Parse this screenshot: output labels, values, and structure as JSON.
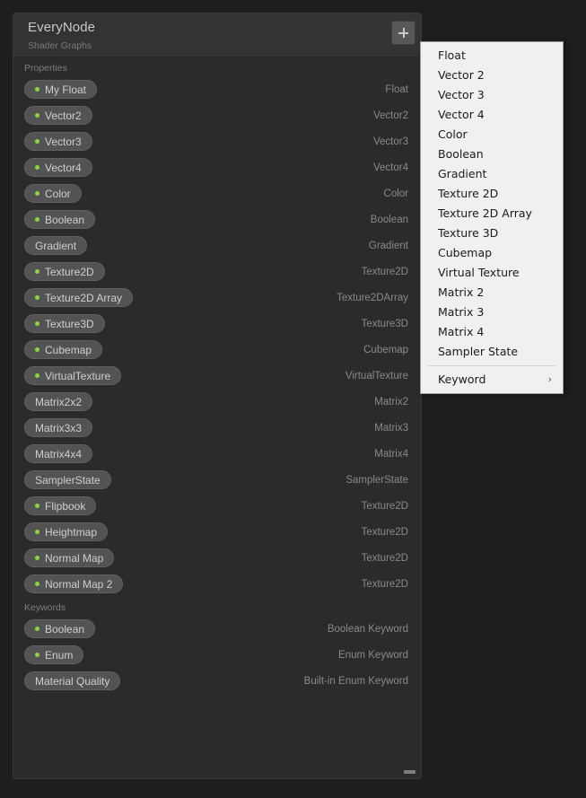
{
  "blackboard": {
    "title": "EveryNode",
    "subtitle": "Shader Graphs",
    "add_button_label": "+",
    "sections": [
      {
        "header": "Properties",
        "rows": [
          {
            "label": "My Float",
            "type": "Float",
            "has_dot": true
          },
          {
            "label": "Vector2",
            "type": "Vector2",
            "has_dot": true
          },
          {
            "label": "Vector3",
            "type": "Vector3",
            "has_dot": true
          },
          {
            "label": "Vector4",
            "type": "Vector4",
            "has_dot": true
          },
          {
            "label": "Color",
            "type": "Color",
            "has_dot": true
          },
          {
            "label": "Boolean",
            "type": "Boolean",
            "has_dot": true
          },
          {
            "label": "Gradient",
            "type": "Gradient",
            "has_dot": false
          },
          {
            "label": "Texture2D",
            "type": "Texture2D",
            "has_dot": true
          },
          {
            "label": "Texture2D Array",
            "type": "Texture2DArray",
            "has_dot": true
          },
          {
            "label": "Texture3D",
            "type": "Texture3D",
            "has_dot": true
          },
          {
            "label": "Cubemap",
            "type": "Cubemap",
            "has_dot": true
          },
          {
            "label": "VirtualTexture",
            "type": "VirtualTexture",
            "has_dot": true
          },
          {
            "label": "Matrix2x2",
            "type": "Matrix2",
            "has_dot": false
          },
          {
            "label": "Matrix3x3",
            "type": "Matrix3",
            "has_dot": false
          },
          {
            "label": "Matrix4x4",
            "type": "Matrix4",
            "has_dot": false
          },
          {
            "label": "SamplerState",
            "type": "SamplerState",
            "has_dot": false
          },
          {
            "label": "Flipbook",
            "type": "Texture2D",
            "has_dot": true
          },
          {
            "label": "Heightmap",
            "type": "Texture2D",
            "has_dot": true
          },
          {
            "label": "Normal Map",
            "type": "Texture2D",
            "has_dot": true
          },
          {
            "label": "Normal Map 2",
            "type": "Texture2D",
            "has_dot": true
          }
        ]
      },
      {
        "header": "Keywords",
        "rows": [
          {
            "label": "Boolean",
            "type": "Boolean Keyword",
            "has_dot": true
          },
          {
            "label": "Enum",
            "type": "Enum Keyword",
            "has_dot": true
          },
          {
            "label": "Material Quality",
            "type": "Built-in Enum Keyword",
            "has_dot": false
          }
        ]
      }
    ]
  },
  "dropdown": {
    "items": [
      {
        "label": "Float",
        "separator_before": false,
        "submenu": false
      },
      {
        "label": "Vector 2",
        "separator_before": false,
        "submenu": false
      },
      {
        "label": "Vector 3",
        "separator_before": false,
        "submenu": false
      },
      {
        "label": "Vector 4",
        "separator_before": false,
        "submenu": false
      },
      {
        "label": "Color",
        "separator_before": false,
        "submenu": false
      },
      {
        "label": "Boolean",
        "separator_before": false,
        "submenu": false
      },
      {
        "label": "Gradient",
        "separator_before": false,
        "submenu": false
      },
      {
        "label": "Texture 2D",
        "separator_before": false,
        "submenu": false
      },
      {
        "label": "Texture 2D Array",
        "separator_before": false,
        "submenu": false
      },
      {
        "label": "Texture 3D",
        "separator_before": false,
        "submenu": false
      },
      {
        "label": "Cubemap",
        "separator_before": false,
        "submenu": false
      },
      {
        "label": "Virtual Texture",
        "separator_before": false,
        "submenu": false
      },
      {
        "label": "Matrix 2",
        "separator_before": false,
        "submenu": false
      },
      {
        "label": "Matrix 3",
        "separator_before": false,
        "submenu": false
      },
      {
        "label": "Matrix 4",
        "separator_before": false,
        "submenu": false
      },
      {
        "label": "Sampler State",
        "separator_before": false,
        "submenu": false
      },
      {
        "label": "Keyword",
        "separator_before": true,
        "submenu": true
      }
    ],
    "submenu_arrow_glyph": "›"
  },
  "colors": {
    "panel_background": "#2b2b2b",
    "header_background": "#333333",
    "outer_background": "#1e1e1e",
    "pill_background": "#535353",
    "dot_green": "#8fd14f",
    "menu_background": "#f0f0f0",
    "menu_text": "#1b1b1b"
  }
}
